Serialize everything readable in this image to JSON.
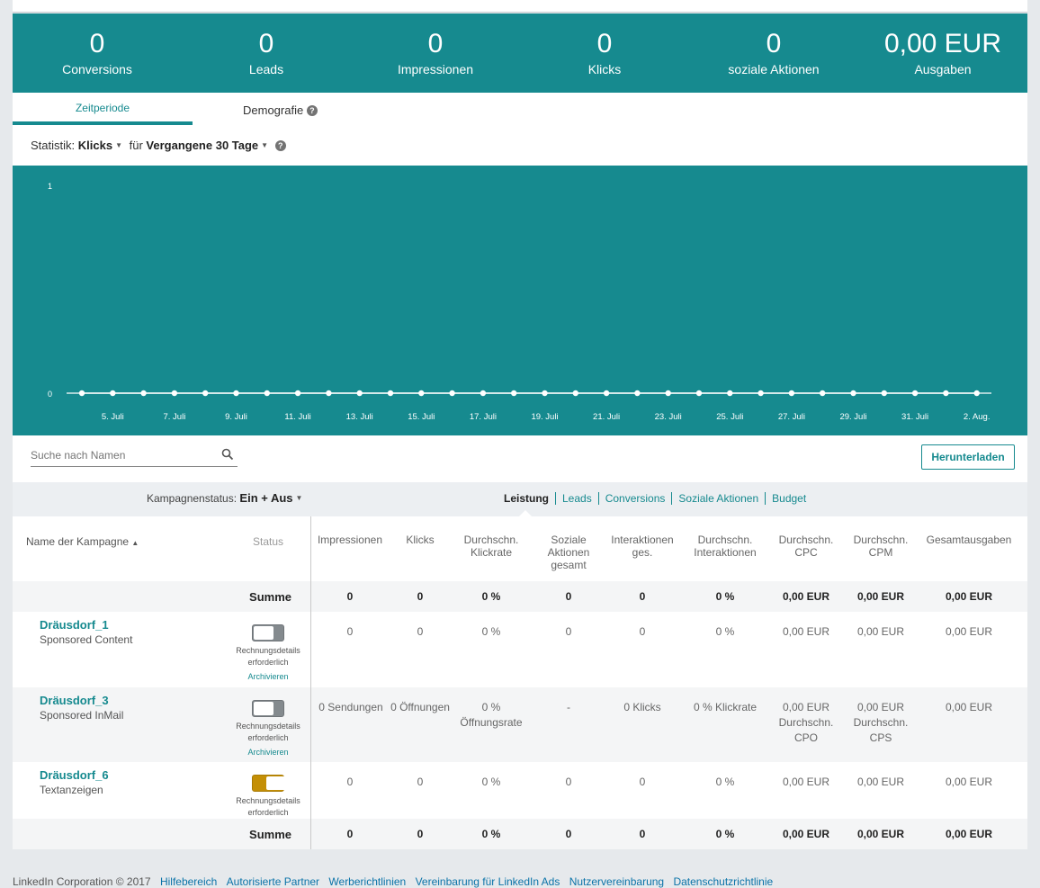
{
  "metrics": [
    {
      "value": "0",
      "label": "Conversions"
    },
    {
      "value": "0",
      "label": "Leads"
    },
    {
      "value": "0",
      "label": "Impressionen"
    },
    {
      "value": "0",
      "label": "Klicks"
    },
    {
      "value": "0",
      "label": "soziale Aktionen"
    },
    {
      "value": "0,00 EUR",
      "label": "Ausgaben"
    }
  ],
  "tabs": {
    "zeitperiode": "Zeitperiode",
    "demografie": "Demografie"
  },
  "statistik": {
    "prefix": "Statistik:",
    "metric": "Klicks",
    "fuer": "für",
    "period": "Vergangene 30 Tage"
  },
  "chart_data": {
    "type": "line",
    "x": [
      "4. Juli",
      "5. Juli",
      "6. Juli",
      "7. Juli",
      "8. Juli",
      "9. Juli",
      "10. Juli",
      "11. Juli",
      "12. Juli",
      "13. Juli",
      "14. Juli",
      "15. Juli",
      "16. Juli",
      "17. Juli",
      "18. Juli",
      "19. Juli",
      "20. Juli",
      "21. Juli",
      "22. Juli",
      "23. Juli",
      "24. Juli",
      "25. Juli",
      "26. Juli",
      "27. Juli",
      "28. Juli",
      "29. Juli",
      "30. Juli",
      "31. Juli",
      "1. Aug.",
      "2. Aug."
    ],
    "tick_labels": [
      "5. Juli",
      "7. Juli",
      "9. Juli",
      "11. Juli",
      "13. Juli",
      "15. Juli",
      "17. Juli",
      "19. Juli",
      "21. Juli",
      "23. Juli",
      "25. Juli",
      "27. Juli",
      "29. Juli",
      "31. Juli",
      "2. Aug."
    ],
    "values": [
      0,
      0,
      0,
      0,
      0,
      0,
      0,
      0,
      0,
      0,
      0,
      0,
      0,
      0,
      0,
      0,
      0,
      0,
      0,
      0,
      0,
      0,
      0,
      0,
      0,
      0,
      0,
      0,
      0,
      0
    ],
    "y_ticks": [
      "1",
      "0"
    ],
    "ylim": [
      0,
      1
    ],
    "colors": {
      "background": "#168a8f",
      "line": "#ffffff"
    }
  },
  "search": {
    "placeholder": "Suche nach Namen"
  },
  "download_label": "Herunterladen",
  "campaign_status": {
    "label": "Kampagnenstatus:",
    "value": "Ein + Aus"
  },
  "views": [
    "Leistung",
    "Leads",
    "Conversions",
    "Soziale Aktionen",
    "Budget"
  ],
  "table": {
    "headers": {
      "name": "Name der Kampagne",
      "status": "Status",
      "impr": "Impressionen",
      "klicks": "Klicks",
      "ctr": "Durchschn. Klickrate",
      "social": "Soziale Aktionen gesamt",
      "inter": "Interaktionen ges.",
      "inter_avg": "Durchschn. Interaktionen",
      "cpc": "Durchschn. CPC",
      "cpm": "Durchschn. CPM",
      "spend": "Gesamtausgaben"
    },
    "sum_label": "Summe",
    "summary": {
      "impr": "0",
      "klicks": "0",
      "ctr": "0 %",
      "social": "0",
      "inter": "0",
      "inter_avg": "0 %",
      "cpc": "0,00 EUR",
      "cpm": "0,00 EUR",
      "spend": "0,00 EUR"
    },
    "billing_note": "Rechnungsdetails erforderlich",
    "archive_label": "Archivieren",
    "rows": [
      {
        "name": "Dräusdorf_1",
        "type": "Sponsored Content",
        "impr": "0",
        "klicks": "0",
        "ctr": "0 %",
        "social": "0",
        "inter": "0",
        "inter_avg": "0 %",
        "cpc": "0,00 EUR",
        "cpm": "0,00 EUR",
        "spend": "0,00 EUR"
      },
      {
        "name": "Dräusdorf_3",
        "type": "Sponsored InMail",
        "impr": "0 Sendungen",
        "klicks": "0 Öffnungen",
        "ctr": "0 % Öffnungsrate",
        "social": "-",
        "inter": "0 Klicks",
        "inter_avg": "0 % Klickrate",
        "cpc": "0,00 EUR Durchschn. CPO",
        "cpm": "0,00 EUR Durchschn. CPS",
        "spend": "0,00 EUR"
      },
      {
        "name": "Dräusdorf_6",
        "type": "Textanzeigen",
        "impr": "0",
        "klicks": "0",
        "ctr": "0 %",
        "social": "0",
        "inter": "0",
        "inter_avg": "0 %",
        "cpc": "0,00 EUR",
        "cpm": "0,00 EUR",
        "spend": "0,00 EUR"
      }
    ]
  },
  "footer": {
    "copyright": "LinkedIn Corporation © 2017",
    "links": [
      "Hilfebereich",
      "Autorisierte Partner",
      "Werberichtlinien",
      "Vereinbarung für LinkedIn Ads",
      "Nutzervereinbarung",
      "Datenschutzrichtlinie"
    ]
  }
}
